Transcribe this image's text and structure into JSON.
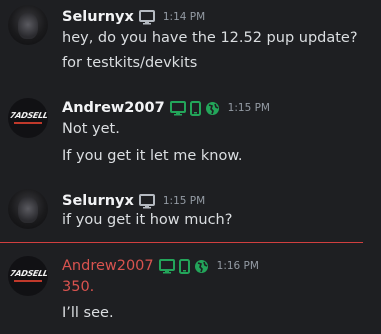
{
  "colors": {
    "background": "#1e1f22",
    "text": "#dbdee1",
    "username": "#f2f3f5",
    "timestamp": "#949ba4",
    "highlight_red": "#d9534f",
    "platform_green": "#23a55a",
    "desktop_gray": "#b5bac1",
    "divider": "#d13f3f"
  },
  "messages": [
    {
      "username": "Selurnyx",
      "icons": [
        "desktop-icon"
      ],
      "timestamp": "1:14 PM",
      "lines": [
        "hey, do you have the 12.52 pup update?",
        "for testkits/devkits"
      ]
    },
    {
      "username": "Andrew2007",
      "icons": [
        "desktop-icon",
        "mobile-icon",
        "web-icon"
      ],
      "timestamp": "1:15 PM",
      "avatar_text": "7ADSELL",
      "lines": [
        "Not yet.",
        "If you get it let me know."
      ]
    },
    {
      "username": "Selurnyx",
      "icons": [
        "desktop-icon"
      ],
      "timestamp": "1:15 PM",
      "lines": [
        "if you get it how much?"
      ]
    },
    {
      "username": "Andrew2007",
      "icons": [
        "desktop-icon",
        "mobile-icon",
        "web-icon"
      ],
      "timestamp": "1:16 PM",
      "avatar_text": "7ADSELL",
      "lines": [
        "350.",
        "I’ll see."
      ]
    }
  ]
}
